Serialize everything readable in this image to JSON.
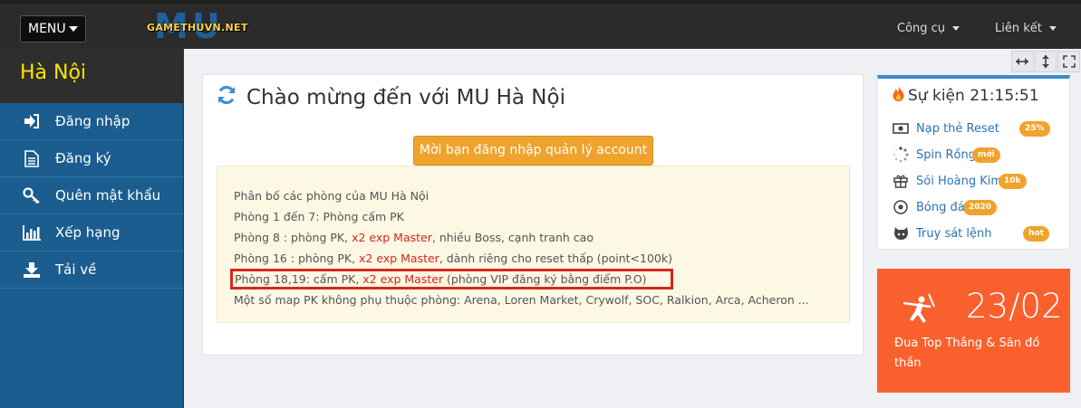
{
  "topbar": {
    "menu_label": "MENU",
    "logo_mark": "MU",
    "logo_text": "GAMETHUVN.NET",
    "nav": [
      {
        "label": "Công cụ"
      },
      {
        "label": "Liên kết"
      }
    ]
  },
  "sidebar": {
    "title": "Hà Nội",
    "items": [
      {
        "label": "Đăng nhập",
        "icon": "sign-in-icon"
      },
      {
        "label": "Đăng ký",
        "icon": "document-icon"
      },
      {
        "label": "Quên mật khẩu",
        "icon": "key-icon"
      },
      {
        "label": "Xếp hạng",
        "icon": "bar-chart-icon"
      },
      {
        "label": "Tải về",
        "icon": "download-icon"
      }
    ]
  },
  "main": {
    "title": "Chào mừng đến với MU Hà Nội",
    "login_button": "Mời bạn đăng nhập quản lý account",
    "info": {
      "line1": "Phân bố các phòng của MU Hà Nội",
      "line2": "Phòng 1 đến 7: Phòng cấm PK",
      "line3_a": "Phòng 8 : phòng PK, ",
      "line3_b": "x2 exp Master",
      "line3_c": ", nhiều Boss, cạnh tranh cao",
      "line4_a": "Phòng 16 : phòng PK, ",
      "line4_b": "x2 exp Master",
      "line4_c": ", dành riêng cho reset thấp (point<100k)",
      "line5_a": "Phòng 18,19: cấm PK, ",
      "line5_b": "x2 exp Master",
      "line5_c": " (phòng VIP đăng ký bằng điểm P.O)",
      "line6": "Một số map PK không phụ thuộc phòng: Arena, Loren Market, Crywolf, SOC, Ralkion, Arca, Acheron ..."
    }
  },
  "events": {
    "title_prefix": "Sự kiện",
    "time": "21:15:51",
    "items": [
      {
        "label": "Nạp thẻ Reset",
        "badge": "25%",
        "icon": "money-icon"
      },
      {
        "label": "Spin Rồng",
        "badge": "mới",
        "icon": "spinner-icon"
      },
      {
        "label": "Sói Hoàng Kim",
        "badge": "10k",
        "icon": "gift-icon"
      },
      {
        "label": "Bóng đá",
        "badge": "2020",
        "icon": "soccer-ball-icon"
      },
      {
        "label": "Truy sát lệnh",
        "badge": "hot",
        "icon": "github-cat-icon"
      }
    ]
  },
  "promo": {
    "date": "23/02",
    "subtitle": "Đua Top Thắng & Săn đồ thần"
  },
  "colors": {
    "sidebar_bg": "#1b5d8e",
    "topbar_bg": "#2b2b2b",
    "accent_orange": "#f0a32c",
    "promo_bg": "#f9602d",
    "highlight_red": "#d9261c",
    "sidebar_title": "#ffe400"
  }
}
